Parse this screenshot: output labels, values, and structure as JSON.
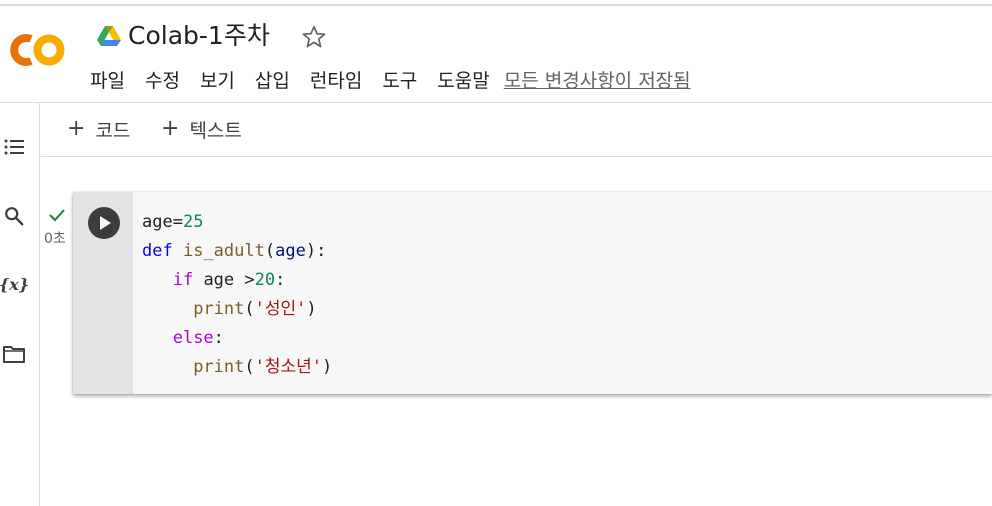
{
  "header": {
    "title": "Colab-1주차",
    "logo_text": "CO",
    "save_status": "모든 변경사항이 저장됨"
  },
  "menu": [
    "파일",
    "수정",
    "보기",
    "삽입",
    "런타임",
    "도구",
    "도움말"
  ],
  "toolbar": {
    "add_code_plus": "+",
    "add_code_label": "코드",
    "add_text_plus": "+",
    "add_text_label": "텍스트"
  },
  "left_rail": {
    "icons": [
      "toc-icon",
      "search-icon",
      "variables-icon",
      "folder-icon"
    ],
    "variables_glyph": "{x}"
  },
  "cell": {
    "execution_time": "0초",
    "status": "completed",
    "code_tokens": {
      "l1_var": "age",
      "l1_eq": "=",
      "l1_num": "25",
      "l2_def": "def",
      "l2_name": "is_adult",
      "l2_open": "(",
      "l2_param": "age",
      "l2_close": "):",
      "l3_if": "if",
      "l3_cond": " age >",
      "l3_num": "20",
      "l3_colon": ":",
      "l4_fn": "print",
      "l4_open": "(",
      "l4_str": "'성인'",
      "l4_close": ")",
      "l5_else": "else",
      "l5_colon": ":",
      "l6_fn": "print",
      "l6_open": "(",
      "l6_str": "'청소년'",
      "l6_close": ")"
    }
  },
  "colors": {
    "logo_orange": "#f9ab00",
    "logo_dark_orange": "#e8710a",
    "keyword_blue": "#0000ff",
    "keyword_purple": "#af00db",
    "number_green": "#098658",
    "string_red": "#a31515",
    "check_green": "#188038"
  }
}
